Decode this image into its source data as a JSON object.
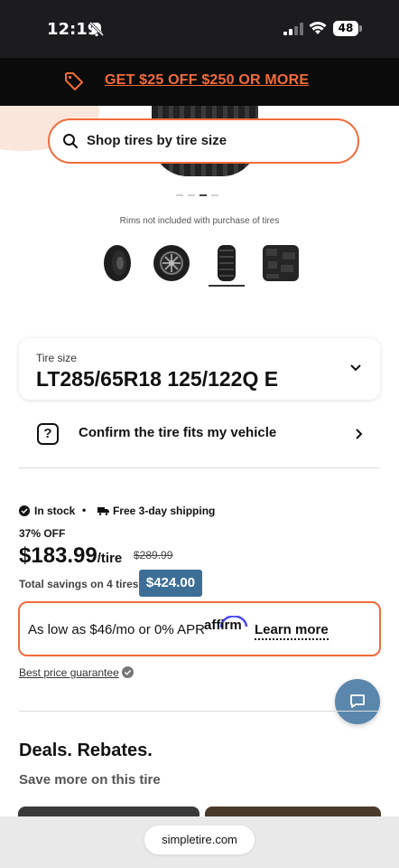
{
  "status_bar": {
    "time": "12:19",
    "battery": "48"
  },
  "promo": {
    "text": "GET $25 OFF $250 OR MORE",
    "icon": "tag-icon",
    "color": "#f26b3a"
  },
  "search": {
    "placeholder": "Shop tires by tire size",
    "icon": "search-icon"
  },
  "gallery": {
    "rims_note": "Rims not included with purchase of tires",
    "slide_count": 4,
    "active_slide": 3,
    "thumbnails": [
      "tire-front-thumb",
      "rim-thumb",
      "tire-side-thumb",
      "tread-thumb"
    ],
    "active_thumbnail": 3
  },
  "tire_size": {
    "label": "Tire size",
    "value": "LT285/65R18 125/122Q E"
  },
  "fit": {
    "label": "Confirm the tire fits my vehicle"
  },
  "stock": {
    "status": "In stock",
    "shipping": "Free 3-day shipping"
  },
  "pricing": {
    "discount": "37% OFF",
    "price": "$183.99",
    "unit": "/tire",
    "old_price": "$289.99",
    "savings_label": "Total savings on 4 tires:",
    "savings_value": "$424.00",
    "accent_color": "#3d6f96"
  },
  "financing": {
    "text": "As low as $46/mo or 0% APR",
    "brand": "affirm",
    "link": "Learn more"
  },
  "guarantee": {
    "text": "Best price guarantee"
  },
  "deals": {
    "title": "Deals. Rebates.",
    "subtitle": "Save more on this tire"
  },
  "browser": {
    "url": "simpletire.com"
  }
}
